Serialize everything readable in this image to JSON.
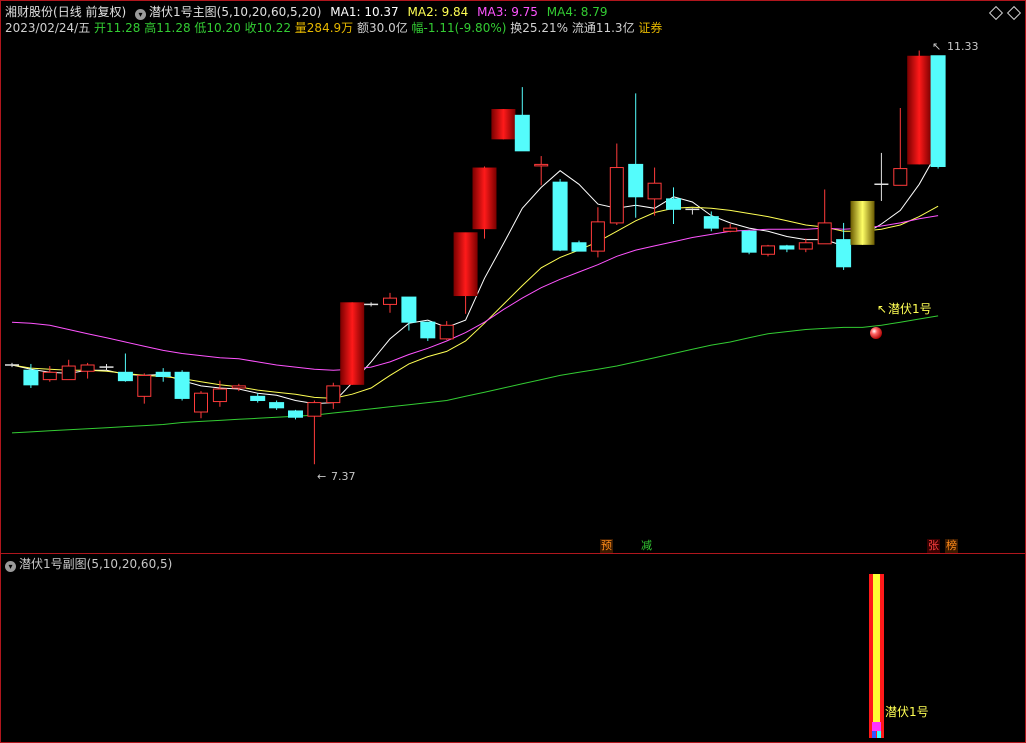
{
  "header": {
    "stock_name": "湘财股份",
    "period": "(日线 前复权)",
    "indicator_main": "潜伏1号主图(5,10,20,60,5,20)",
    "ma1": "MA1: 10.37",
    "ma2": "MA2: 9.84",
    "ma3": "MA3: 9.75",
    "ma4": "MA4: 8.79",
    "date": "2023/02/24/五",
    "open": "开11.28",
    "high": "高11.28",
    "low": "低10.20",
    "close": "收10.22",
    "volume": "量284.9万",
    "amount": "额30.0亿",
    "change": "幅-1.11(-9.80%)",
    "turnover": "换25.21%",
    "float_cap": "流通11.3亿",
    "sector": "证券"
  },
  "annotations": {
    "low_mark": "7.37",
    "high_mark": "11.33",
    "signal_label": "潜伏1号",
    "tag_yu": "预",
    "tag_jian": "减",
    "tag_zhang": "张",
    "tag_bang": "榜"
  },
  "sub_chart": {
    "title": "潜伏1号副图(5,10,20,60,5)",
    "signal_label": "潜伏1号"
  },
  "colors": {
    "up": "#ff3b3b",
    "down": "#54fcfc",
    "ma1": "#ffffff",
    "ma2": "#ffff54",
    "ma3": "#ff54ff",
    "ma4": "#33cc33",
    "frame": "#b0161d"
  },
  "chart_data": {
    "type": "candlestick",
    "price_range": [
      7.2,
      11.45
    ],
    "x": [
      1,
      2,
      3,
      4,
      5,
      6,
      7,
      8,
      9,
      10,
      11,
      12,
      13,
      14,
      15,
      16,
      17,
      18,
      19,
      20,
      21,
      22,
      23,
      24,
      25,
      26,
      27,
      28,
      29,
      30,
      31,
      32,
      33,
      34,
      35,
      36,
      37,
      38,
      39,
      40,
      41,
      42,
      43,
      44,
      45,
      46,
      47,
      48,
      49,
      50
    ],
    "candles": [
      {
        "o": 8.32,
        "h": 8.34,
        "l": 8.3,
        "c": 8.32,
        "s": "x"
      },
      {
        "o": 8.27,
        "h": 8.33,
        "l": 8.1,
        "c": 8.13,
        "s": "d"
      },
      {
        "o": 8.18,
        "h": 8.31,
        "l": 8.16,
        "c": 8.25,
        "s": "u"
      },
      {
        "o": 8.18,
        "h": 8.37,
        "l": 8.18,
        "c": 8.31,
        "s": "u"
      },
      {
        "o": 8.26,
        "h": 8.34,
        "l": 8.19,
        "c": 8.32,
        "s": "u"
      },
      {
        "o": 8.3,
        "h": 8.33,
        "l": 8.27,
        "c": 8.3,
        "s": "x"
      },
      {
        "o": 8.25,
        "h": 8.43,
        "l": 8.16,
        "c": 8.17,
        "s": "d"
      },
      {
        "o": 8.02,
        "h": 8.24,
        "l": 7.95,
        "c": 8.22,
        "s": "u"
      },
      {
        "o": 8.25,
        "h": 8.29,
        "l": 8.16,
        "c": 8.21,
        "s": "d"
      },
      {
        "o": 8.25,
        "h": 8.27,
        "l": 7.98,
        "c": 8.0,
        "s": "d"
      },
      {
        "o": 7.87,
        "h": 8.07,
        "l": 7.81,
        "c": 8.05,
        "s": "u"
      },
      {
        "o": 7.97,
        "h": 8.17,
        "l": 7.92,
        "c": 8.09,
        "s": "u"
      },
      {
        "o": 8.1,
        "h": 8.14,
        "l": 8.07,
        "c": 8.12,
        "s": "u"
      },
      {
        "o": 8.02,
        "h": 8.05,
        "l": 7.96,
        "c": 7.98,
        "s": "d"
      },
      {
        "o": 7.96,
        "h": 7.98,
        "l": 7.89,
        "c": 7.91,
        "s": "d"
      },
      {
        "o": 7.88,
        "h": 7.89,
        "l": 7.8,
        "c": 7.82,
        "s": "d"
      },
      {
        "o": 7.83,
        "h": 7.98,
        "l": 7.37,
        "c": 7.96,
        "s": "u"
      },
      {
        "o": 7.96,
        "h": 8.15,
        "l": 7.9,
        "c": 8.12,
        "s": "u"
      },
      {
        "o": 8.13,
        "h": 8.92,
        "l": 8.13,
        "c": 8.92,
        "s": "b"
      },
      {
        "o": 8.9,
        "h": 8.92,
        "l": 8.88,
        "c": 8.9,
        "s": "x"
      },
      {
        "o": 8.9,
        "h": 9.01,
        "l": 8.82,
        "c": 8.96,
        "s": "u"
      },
      {
        "o": 8.97,
        "h": 8.97,
        "l": 8.65,
        "c": 8.73,
        "s": "d"
      },
      {
        "o": 8.73,
        "h": 8.73,
        "l": 8.55,
        "c": 8.58,
        "s": "d"
      },
      {
        "o": 8.57,
        "h": 8.74,
        "l": 8.56,
        "c": 8.7,
        "s": "u"
      },
      {
        "o": 8.98,
        "h": 9.58,
        "l": 8.81,
        "c": 9.59,
        "s": "b"
      },
      {
        "o": 9.62,
        "h": 10.22,
        "l": 9.53,
        "c": 10.21,
        "s": "b"
      },
      {
        "o": 10.77,
        "h": 10.77,
        "l": 10.48,
        "c": 10.48,
        "s": "b"
      },
      {
        "o": 10.71,
        "h": 10.98,
        "l": 10.37,
        "c": 10.37,
        "s": "d"
      },
      {
        "o": 10.24,
        "h": 10.32,
        "l": 10.04,
        "c": 10.24,
        "s": "u"
      },
      {
        "o": 10.07,
        "h": 10.1,
        "l": 9.41,
        "c": 9.42,
        "s": "d"
      },
      {
        "o": 9.41,
        "h": 9.51,
        "l": 9.41,
        "c": 9.49,
        "s": "d"
      },
      {
        "o": 9.41,
        "h": 9.83,
        "l": 9.35,
        "c": 9.69,
        "s": "u"
      },
      {
        "o": 9.68,
        "h": 10.44,
        "l": 9.66,
        "c": 10.21,
        "s": "u"
      },
      {
        "o": 10.24,
        "h": 10.92,
        "l": 9.73,
        "c": 9.93,
        "s": "d"
      },
      {
        "o": 10.06,
        "h": 10.21,
        "l": 9.75,
        "c": 9.91,
        "s": "u"
      },
      {
        "o": 9.91,
        "h": 10.02,
        "l": 9.67,
        "c": 9.81,
        "s": "d"
      },
      {
        "o": 9.81,
        "h": 9.82,
        "l": 9.76,
        "c": 9.78,
        "s": "x"
      },
      {
        "o": 9.74,
        "h": 9.79,
        "l": 9.6,
        "c": 9.63,
        "s": "d"
      },
      {
        "o": 9.63,
        "h": 9.67,
        "l": 9.59,
        "c": 9.6,
        "s": "u"
      },
      {
        "o": 9.6,
        "h": 9.61,
        "l": 9.38,
        "c": 9.4,
        "s": "d"
      },
      {
        "o": 9.38,
        "h": 9.47,
        "l": 9.36,
        "c": 9.46,
        "s": "u"
      },
      {
        "o": 9.46,
        "h": 9.47,
        "l": 9.4,
        "c": 9.43,
        "s": "d"
      },
      {
        "o": 9.43,
        "h": 9.53,
        "l": 9.4,
        "c": 9.49,
        "s": "u"
      },
      {
        "o": 9.48,
        "h": 10.0,
        "l": 9.48,
        "c": 9.68,
        "s": "u"
      },
      {
        "o": 9.52,
        "h": 9.68,
        "l": 9.23,
        "c": 9.26,
        "s": "d"
      },
      {
        "o": 9.47,
        "h": 9.89,
        "l": 9.47,
        "c": 9.89,
        "s": "g"
      },
      {
        "o": 10.05,
        "h": 10.35,
        "l": 9.89,
        "c": 10.05,
        "s": "x"
      },
      {
        "o": 10.04,
        "h": 10.78,
        "l": 10.04,
        "c": 10.2,
        "s": "u"
      },
      {
        "o": 10.24,
        "h": 11.33,
        "l": 10.24,
        "c": 11.28,
        "s": "b"
      },
      {
        "o": 11.28,
        "h": 11.28,
        "l": 10.2,
        "c": 10.22,
        "s": "d"
      }
    ],
    "series": [
      {
        "name": "MA1",
        "values": [
          8.32,
          8.28,
          8.25,
          8.24,
          8.27,
          8.27,
          8.23,
          8.22,
          8.23,
          8.17,
          8.12,
          8.1,
          8.09,
          8.05,
          8.03,
          7.98,
          7.95,
          7.96,
          8.15,
          8.35,
          8.57,
          8.72,
          8.75,
          8.68,
          8.75,
          9.15,
          9.48,
          9.82,
          10.02,
          10.18,
          10.05,
          9.86,
          9.82,
          9.85,
          9.82,
          9.93,
          9.88,
          9.75,
          9.68,
          9.63,
          9.6,
          9.55,
          9.52,
          9.52,
          9.46,
          9.56,
          9.67,
          9.8,
          10.05,
          10.37
        ]
      },
      {
        "name": "MA2",
        "values": [
          8.32,
          8.29,
          8.28,
          8.27,
          8.27,
          8.26,
          8.24,
          8.22,
          8.21,
          8.19,
          8.16,
          8.13,
          8.11,
          8.08,
          8.06,
          8.04,
          8.01,
          8.0,
          8.04,
          8.1,
          8.22,
          8.33,
          8.4,
          8.45,
          8.55,
          8.72,
          8.9,
          9.08,
          9.25,
          9.35,
          9.42,
          9.5,
          9.6,
          9.7,
          9.78,
          9.82,
          9.83,
          9.82,
          9.8,
          9.77,
          9.74,
          9.7,
          9.66,
          9.64,
          9.6,
          9.6,
          9.62,
          9.66,
          9.74,
          9.84
        ]
      },
      {
        "name": "MA3",
        "values": [
          8.73,
          8.72,
          8.7,
          8.66,
          8.62,
          8.58,
          8.54,
          8.5,
          8.46,
          8.43,
          8.41,
          8.39,
          8.38,
          8.35,
          8.32,
          8.3,
          8.28,
          8.27,
          8.28,
          8.3,
          8.35,
          8.42,
          8.48,
          8.55,
          8.63,
          8.73,
          8.85,
          8.96,
          9.06,
          9.14,
          9.21,
          9.28,
          9.36,
          9.42,
          9.46,
          9.5,
          9.54,
          9.57,
          9.6,
          9.61,
          9.62,
          9.62,
          9.62,
          9.63,
          9.62,
          9.63,
          9.65,
          9.68,
          9.72,
          9.75
        ]
      },
      {
        "name": "MA4",
        "values": [
          7.67,
          7.68,
          7.69,
          7.7,
          7.71,
          7.72,
          7.73,
          7.74,
          7.75,
          7.77,
          7.78,
          7.79,
          7.8,
          7.81,
          7.82,
          7.83,
          7.84,
          7.86,
          7.88,
          7.9,
          7.92,
          7.94,
          7.96,
          7.98,
          8.02,
          8.06,
          8.1,
          8.14,
          8.18,
          8.22,
          8.25,
          8.28,
          8.31,
          8.35,
          8.39,
          8.43,
          8.47,
          8.51,
          8.54,
          8.58,
          8.62,
          8.64,
          8.66,
          8.67,
          8.68,
          8.68,
          8.7,
          8.73,
          8.76,
          8.79
        ]
      }
    ],
    "signal": {
      "index": 46,
      "label": "潜伏1号"
    }
  }
}
